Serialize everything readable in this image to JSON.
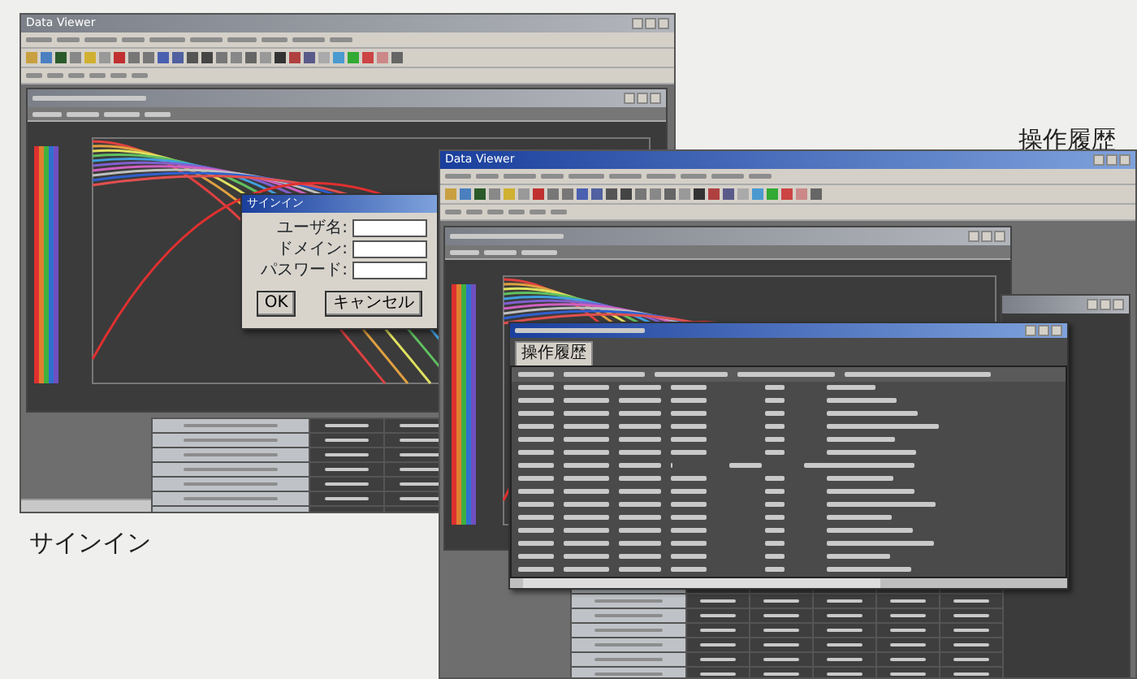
{
  "signin_screen": {
    "window": {
      "title": "Data Viewer",
      "active": false
    },
    "dialog": {
      "title": "サインイン",
      "fields": [
        {
          "label": "ユーザ名:"
        },
        {
          "label": "ドメイン:"
        },
        {
          "label": "パスワード:"
        }
      ],
      "buttons": [
        "OK",
        "キャンセル"
      ]
    },
    "caption": "サインイン"
  },
  "history_screen": {
    "window": {
      "title": "Data Viewer",
      "active": true
    },
    "dialog": {
      "tabs": [
        {
          "label": "操作履歴",
          "selected": true
        }
      ]
    },
    "caption": "操作履歴"
  }
}
